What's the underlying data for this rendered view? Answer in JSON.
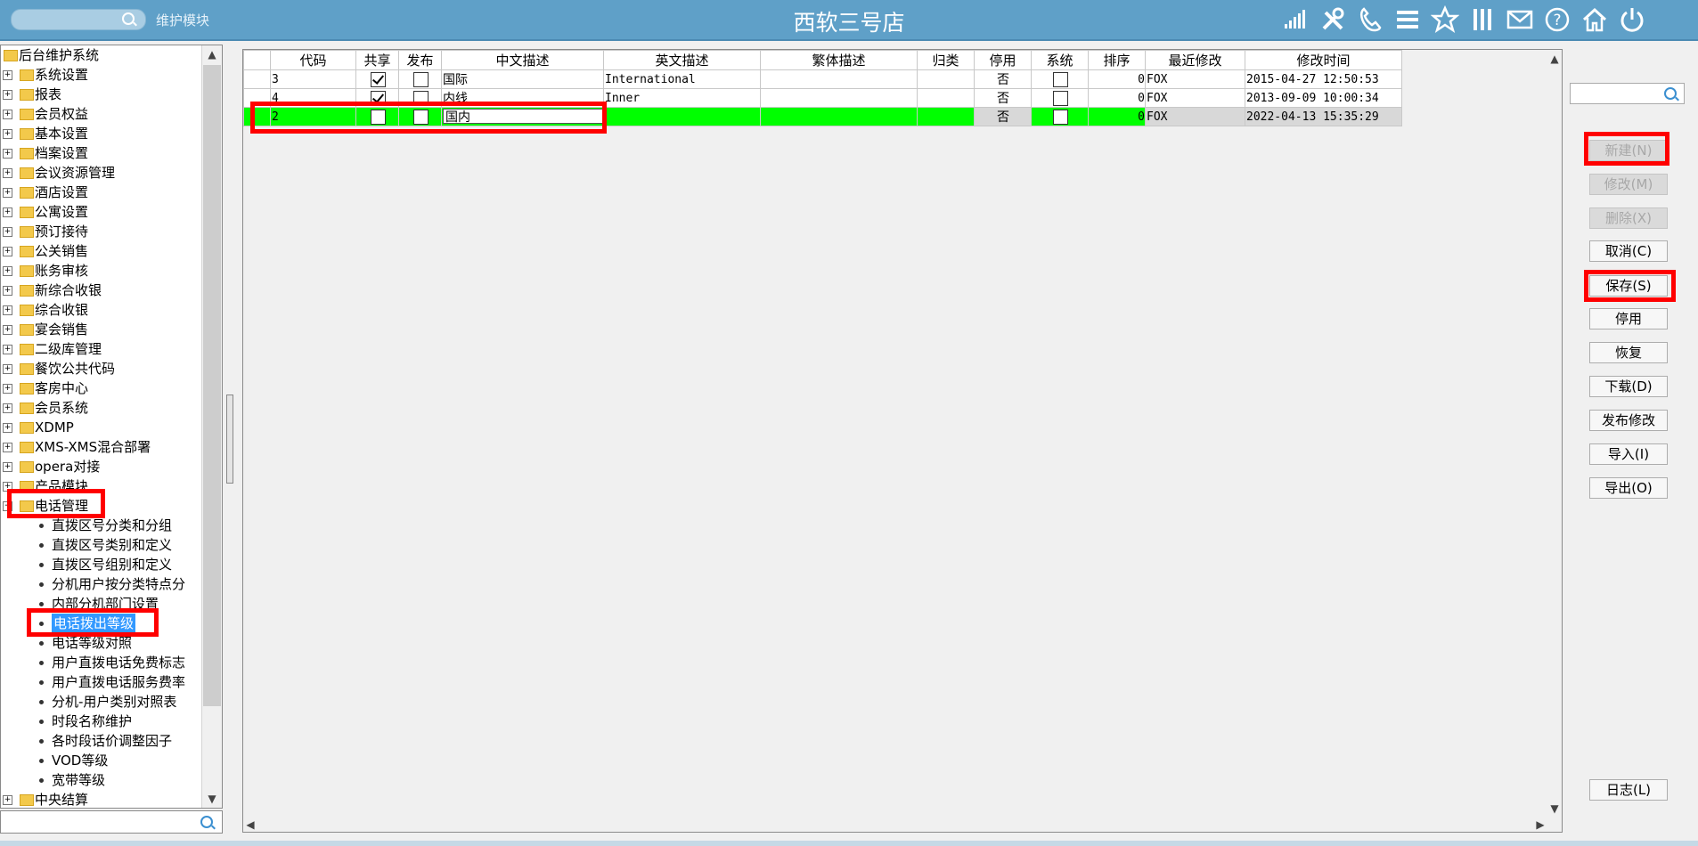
{
  "titlebar": {
    "module_label": "维护模块",
    "app_title": "西软三号店",
    "icons": [
      "signal-icon",
      "tools-icon",
      "phone-icon",
      "menu-icon",
      "star-icon",
      "columns-icon",
      "mail-icon",
      "help-icon",
      "home-icon",
      "power-icon"
    ]
  },
  "tree": {
    "root": "后台维护系统",
    "groups": [
      "系统设置",
      "报表",
      "会员权益",
      "基本设置",
      "档案设置",
      "会议资源管理",
      "酒店设置",
      "公寓设置",
      "预订接待",
      "公关销售",
      "账务审核",
      "新综合收银",
      "综合收银",
      "宴会销售",
      "二级库管理",
      "餐饮公共代码",
      "客房中心",
      "会员系统",
      "XDMP",
      "XMS-XMS混合部署",
      "opera对接",
      "产品模块"
    ],
    "expanded_group": "电话管理",
    "children": [
      "直拨区号分类和分组",
      "直拨区号类别和定义",
      "直拨区号组别和定义",
      "分机用户按分类特点分",
      "内部分机部门设置",
      "电话拨出等级",
      "电话等级对照",
      "用户直拨电话免费标志",
      "用户直拨电话服务费率",
      "分机-用户类别对照表",
      "时段名称维护",
      "各时段话价调整因子",
      "VOD等级",
      "宽带等级"
    ],
    "selected_child": "电话拨出等级",
    "last_group": "中央结算"
  },
  "grid": {
    "columns": [
      "代码",
      "共享",
      "发布",
      "中文描述",
      "英文描述",
      "繁体描述",
      "归类",
      "停用",
      "系统",
      "排序",
      "最近修改",
      "修改时间"
    ],
    "rows": [
      {
        "code": "3",
        "shared": true,
        "published": false,
        "cn": "国际",
        "en": "International",
        "tw": "",
        "category": "",
        "disabled": "否",
        "system": false,
        "order": "0",
        "modified_by": "FOX",
        "modified_at": "2015-04-27 12:50:53"
      },
      {
        "code": "4",
        "shared": true,
        "published": false,
        "cn": "内线",
        "en": "Inner",
        "tw": "",
        "category": "",
        "disabled": "否",
        "system": false,
        "order": "0",
        "modified_by": "FOX",
        "modified_at": "2013-09-09 10:00:34"
      },
      {
        "code": "2",
        "shared": false,
        "published": false,
        "cn": "国内",
        "en": "",
        "tw": "",
        "category": "",
        "disabled": "否",
        "system": false,
        "order": "0",
        "modified_by": "FOX",
        "modified_at": "2022-04-13 15:35:29"
      }
    ]
  },
  "buttons": {
    "new": "新建(N)",
    "modify": "修改(M)",
    "delete": "删除(X)",
    "cancel": "取消(C)",
    "save": "保存(S)",
    "disable": "停用",
    "restore": "恢复",
    "download": "下载(D)",
    "publish": "发布修改",
    "import": "导入(I)",
    "export": "导出(O)",
    "log": "日志(L)"
  },
  "colors": {
    "titlebar": "#5fa0c8",
    "editing_row": "#00ff00",
    "highlight": "#ff0000",
    "selection": "#3399ff"
  }
}
